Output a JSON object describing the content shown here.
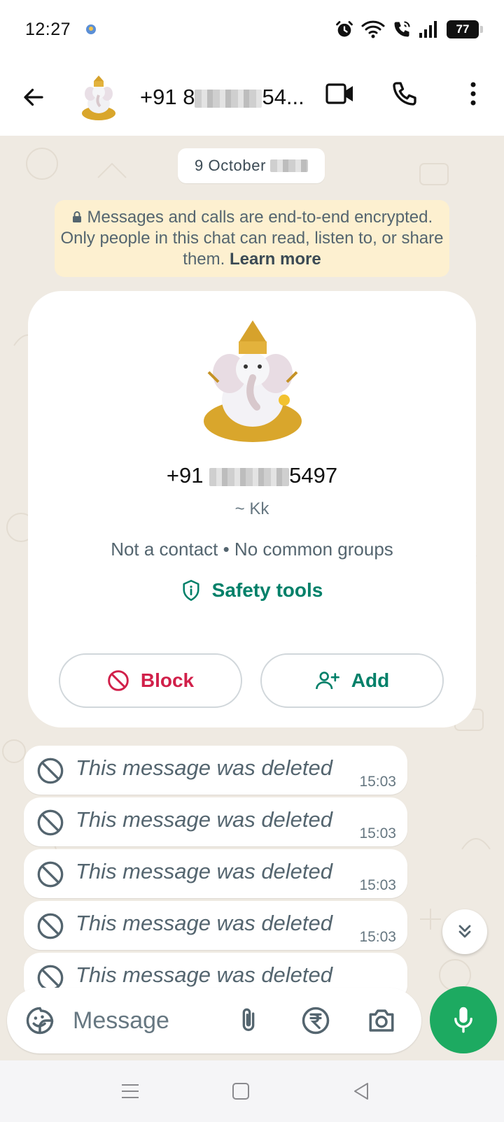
{
  "status_bar": {
    "time": "12:27",
    "battery": "77"
  },
  "header": {
    "title_prefix": "+91 8",
    "title_suffix": "54..."
  },
  "chat": {
    "date_chip": "9 October",
    "encryption_notice": "Messages and calls are end-to-end encrypted. Only people in this chat can read, listen to, or share them.",
    "encryption_link": "Learn more",
    "contact_card": {
      "phone_prefix": "+91",
      "phone_suffix": "5497",
      "nickname": "~ Kk",
      "subtitle": "Not a contact • No common groups",
      "safety_tools": "Safety tools",
      "block_label": "Block",
      "add_label": "Add"
    },
    "messages": [
      {
        "text": "This message was deleted",
        "time": "15:03"
      },
      {
        "text": "This message was deleted",
        "time": "15:03"
      },
      {
        "text": "This message was deleted",
        "time": "15:03"
      },
      {
        "text": "This message was deleted",
        "time": "15:03"
      },
      {
        "text": "This message was deleted",
        "time": ""
      }
    ]
  },
  "composer": {
    "placeholder": "Message"
  },
  "colors": {
    "accent": "#008069",
    "mic": "#1daa61",
    "danger": "#d1204a",
    "encryption_bg": "#fdf0d0",
    "chat_bg": "#efeae2"
  }
}
